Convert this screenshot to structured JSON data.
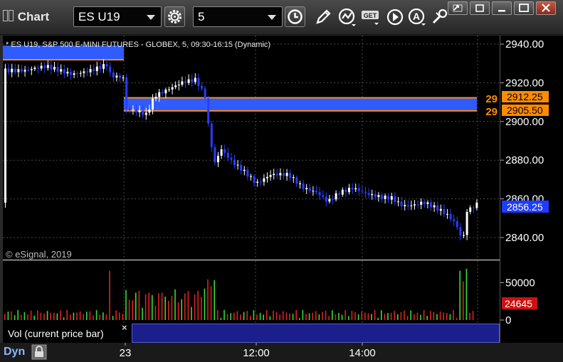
{
  "window": {
    "title": "Chart",
    "symbol": "ES U19",
    "interval": "5"
  },
  "chart": {
    "header": "* ES U19, S&P 500 E-MINI FUTURES - GLOBEX, 5, 09:30-16:15 (Dynamic)",
    "copyright": "© eSignal, 2019",
    "levels": [
      {
        "label": "29",
        "price": "2912.25",
        "value": 2912.25
      },
      {
        "label": "29",
        "price": "2905.50",
        "value": 2905.5
      }
    ],
    "last_price": "2856.25",
    "price_ticks": [
      "2940.00",
      "2920.00",
      "2900.00",
      "2880.00",
      "2860.00",
      "2840.00"
    ],
    "volume_ticks": [
      "50000",
      "25000",
      "0"
    ],
    "volume_last": "24645",
    "volume_study": "Vol (current price bar)",
    "time_labels": [
      "23",
      "12:00",
      "14:00"
    ],
    "dyn_label": "Dyn",
    "close_glyph": "×"
  },
  "colors": {
    "up": "#ffffff",
    "down": "#2a3cff",
    "zone": "#2f5bff",
    "level": "#ff8c00",
    "vol_up": "#33dd33",
    "vol_down": "#dd2222",
    "last_price_bg": "#1e3cff",
    "volume_last_bg": "#cc1111"
  },
  "icons": [
    "gear-icon",
    "clock-icon",
    "pencil-icon",
    "study-icon",
    "get-icon",
    "play-icon",
    "alert-icon",
    "tools-icon"
  ]
}
